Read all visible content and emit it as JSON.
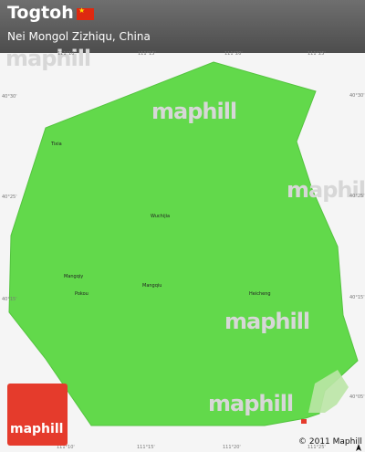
{
  "header": {
    "title": "Togtoh",
    "subtitle": "Nei Mongol Zizhiqu, China"
  },
  "map": {
    "region_color": "#62d94b",
    "background_color": "#f5f5f5",
    "places": [
      "Tixia",
      "Wuchijia",
      "Mangqiy",
      "Pokou",
      "Mangqiu",
      "Heicheng"
    ],
    "coordinates": {
      "top": [
        "111°10'",
        "111°15'",
        "111°20'",
        "111°25'"
      ],
      "bottom": [
        "111°10'",
        "111°15'",
        "111°20'",
        "111°25'"
      ],
      "left": [
        "40°30'",
        "40°25'",
        "40°15'"
      ],
      "right": [
        "40°30'",
        "40°25'",
        "40°15'",
        "40°05'"
      ]
    }
  },
  "branding": {
    "logo_text": "maphill",
    "watermark": "maphill",
    "copyright": "© 2011 Maphill"
  }
}
